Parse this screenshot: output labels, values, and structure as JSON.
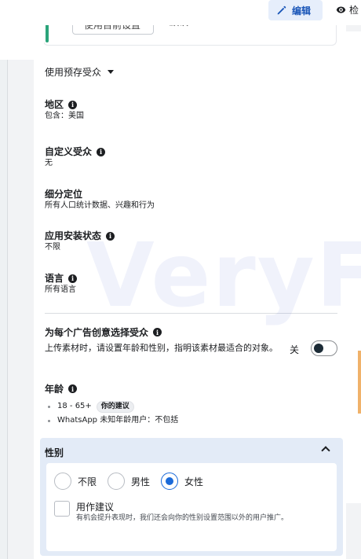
{
  "toolbar": {
    "edit_label": "编辑",
    "view_label": "检"
  },
  "previous_card": {
    "button_text": "使用目前设置",
    "trailing_text": "默认"
  },
  "saved_audience": {
    "label": "使用预存受众"
  },
  "fields": {
    "location": {
      "label": "地区",
      "value": "包含：美国"
    },
    "custom_audience": {
      "label": "自定义受众",
      "value": "无"
    },
    "detailed_targeting": {
      "label": "细分定位",
      "value": "所有人口统计数据、兴趣和行为"
    },
    "app_install_state": {
      "label": "应用安装状态",
      "value": "不限"
    },
    "language": {
      "label": "语言",
      "value": "所有语言"
    }
  },
  "per_creative": {
    "title": "为每个广告创意选择受众",
    "description": "上传素材时，请设置年龄和性别，指明该素材最适合的对象。",
    "toggle_label": "关",
    "toggle_on": false
  },
  "age": {
    "label": "年龄",
    "items": [
      {
        "text": "18 - 65+",
        "badge": "你的建议"
      },
      {
        "text": "WhatsApp 未知年龄用户：不包括",
        "badge": ""
      }
    ]
  },
  "gender": {
    "header": "性别",
    "options": [
      {
        "label": "不限",
        "checked": false
      },
      {
        "label": "男性",
        "checked": false
      },
      {
        "label": "女性",
        "checked": true
      }
    ],
    "suggestion": {
      "title": "用作建议",
      "subtitle": "有机会提升表现时，我们还会向你的性别设置范围以外的用户推广。",
      "checked": false
    }
  },
  "watermark": "VeryFb",
  "colors": {
    "accent_blue": "#1a6ad9",
    "edit_bg": "#e6eefb",
    "section_bg": "#e3ebf7",
    "green_accent": "#2aa47a"
  }
}
